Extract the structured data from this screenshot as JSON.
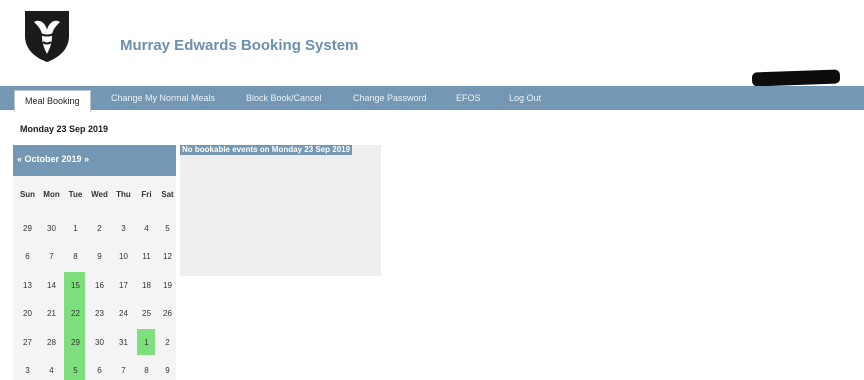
{
  "header": {
    "app_title": "Murray Edwards Booking System",
    "logo_icon": "college-crest-icon"
  },
  "nav": {
    "tabs": [
      {
        "label": "Meal Booking",
        "active": true
      },
      {
        "label": "Change My Normal Meals"
      },
      {
        "label": "Block Book/Cancel"
      },
      {
        "label": "Change Password"
      },
      {
        "label": "EFOS"
      },
      {
        "label": "Log Out"
      }
    ]
  },
  "selected_date": "Monday 23 Sep 2019",
  "calendar": {
    "prev": "«",
    "month_label": "October 2019",
    "next": "»",
    "weekdays": [
      "Sun",
      "Mon",
      "Tue",
      "Wed",
      "Thu",
      "Fri",
      "Sat"
    ],
    "weeks": [
      [
        "29",
        "30",
        "1",
        "2",
        "3",
        "4",
        "5"
      ],
      [
        "6",
        "7",
        "8",
        "9",
        "10",
        "11",
        "12"
      ],
      [
        "13",
        "14",
        "15",
        "16",
        "17",
        "18",
        "19"
      ],
      [
        "20",
        "21",
        "22",
        "23",
        "24",
        "25",
        "26"
      ],
      [
        "27",
        "28",
        "29",
        "30",
        "31",
        "1",
        "2"
      ],
      [
        "3",
        "4",
        "5",
        "6",
        "7",
        "8",
        "9"
      ]
    ],
    "highlight_color": "#7de07d"
  },
  "events": {
    "message": "No bookable events on Monday 23 Sep 2019"
  },
  "colors": {
    "nav_bar": "#7497b3",
    "title": "#6c8fae"
  }
}
